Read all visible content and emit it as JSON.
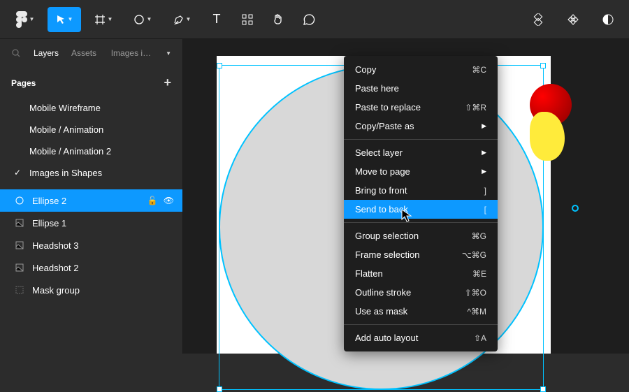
{
  "tabs": {
    "layers": "Layers",
    "assets": "Assets",
    "file": "Images i…"
  },
  "sections": {
    "pages": "Pages"
  },
  "pages": [
    "Mobile Wireframe",
    "Mobile / Animation",
    "Mobile / Animation 2",
    "Images in Shapes"
  ],
  "layers": [
    "Ellipse 2",
    "Ellipse 1",
    "Headshot 3",
    "Headshot 2",
    "Mask group"
  ],
  "menu": {
    "copy": "Copy",
    "copy_s": "⌘C",
    "paste_here": "Paste here",
    "paste_replace": "Paste to replace",
    "paste_replace_s": "⇧⌘R",
    "copy_paste_as": "Copy/Paste as",
    "select_layer": "Select layer",
    "move_page": "Move to page",
    "bring_front": "Bring to front",
    "bring_front_s": "]",
    "send_back": "Send to back",
    "send_back_s": "[",
    "group": "Group selection",
    "group_s": "⌘G",
    "frame": "Frame selection",
    "frame_s": "⌥⌘G",
    "flatten": "Flatten",
    "flatten_s": "⌘E",
    "outline": "Outline stroke",
    "outline_s": "⇧⌘O",
    "mask": "Use as mask",
    "mask_s": "^⌘M",
    "auto_layout": "Add auto layout",
    "auto_layout_s": "⇧A"
  }
}
